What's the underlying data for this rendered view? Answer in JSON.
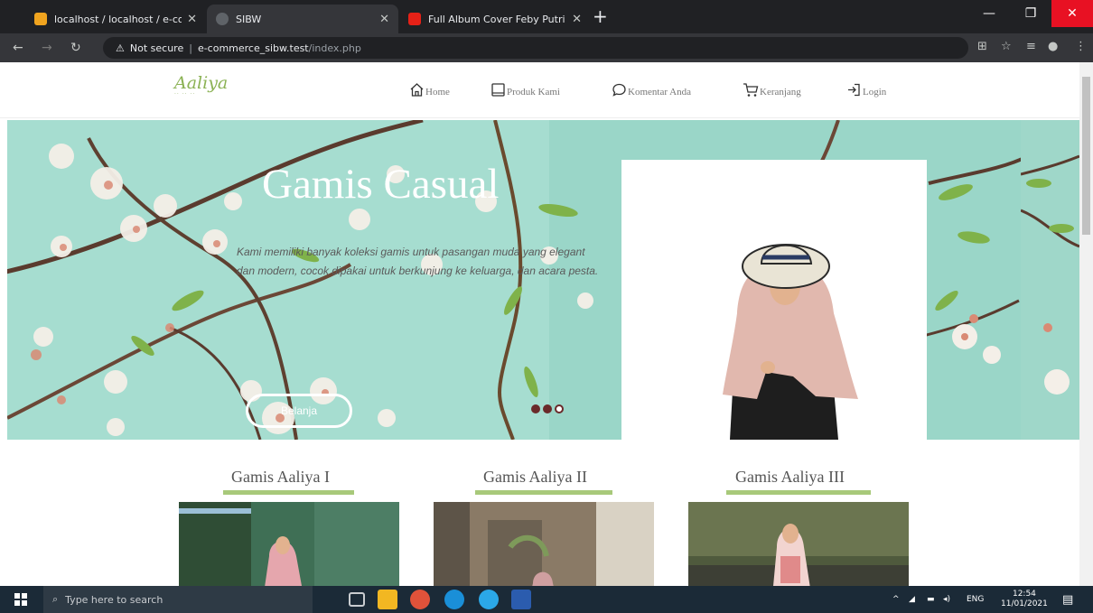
{
  "browser": {
    "tabs": [
      {
        "title": "localhost / localhost / e-comme",
        "active": false
      },
      {
        "title": "SIBW",
        "active": true
      },
      {
        "title": "Full Album Cover Feby Putri",
        "active": false
      }
    ],
    "new_tab": "+",
    "url_warning": "Not secure",
    "url_host": "e-commerce_sibw.test",
    "url_path": "/index.php"
  },
  "nav": {
    "logo_text": "Aaliya",
    "logo_sub": "·· ·· ··",
    "items": [
      {
        "label": "Home",
        "icon": "home-icon"
      },
      {
        "label": "Produk Kami",
        "icon": "tablet-icon"
      },
      {
        "label": "Komentar Anda",
        "icon": "chat-icon"
      },
      {
        "label": "Keranjang",
        "icon": "cart-icon"
      },
      {
        "label": "Login",
        "icon": "login-icon"
      }
    ]
  },
  "hero": {
    "title": "Gamis Casual",
    "text": "Kami memiliki banyak koleksi gamis untuk pasangan muda yang elegant dan modern, cocok dipakai untuk berkunjung ke keluarga, dan acara pesta.",
    "button": "Belanja",
    "slides": 3,
    "active_slide": 1
  },
  "products": [
    {
      "title": "Gamis Aaliya I"
    },
    {
      "title": "Gamis Aaliya II"
    },
    {
      "title": "Gamis Aaliya III"
    }
  ],
  "taskbar": {
    "search_placeholder": "Type here to search",
    "lang": "ENG",
    "time": "12:54",
    "date": "11/01/2021"
  },
  "colors": {
    "accent": "#a8c97a",
    "hero_bg": "#a4dccf",
    "logo": "#8bb254"
  }
}
